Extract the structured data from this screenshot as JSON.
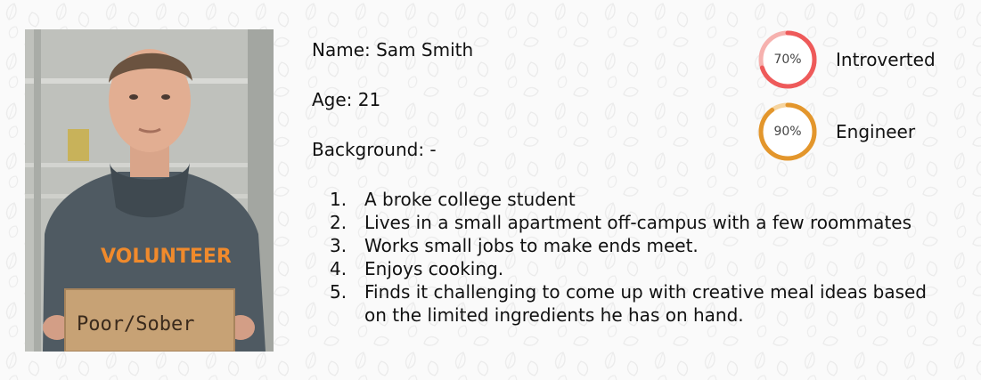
{
  "persona": {
    "name_line": "Name: Sam Smith",
    "age_line": "Age: 21",
    "background_line": "Background: -",
    "items": [
      {
        "num": "1.",
        "text": "A broke college student"
      },
      {
        "num": "2.",
        "text": "Lives in a small apartment off-campus with a few roommates"
      },
      {
        "num": "3.",
        "text": "Works small jobs to make ends meet."
      },
      {
        "num": "4.",
        "text": "Enjoys cooking."
      },
      {
        "num": "5.",
        "text": "Finds it challenging to come up with creative meal ideas based on the limited ingredients he has on hand."
      }
    ]
  },
  "photo": {
    "sign_text": "Poor/Sober",
    "shirt_text": "VOLUNTEER"
  },
  "stats": [
    {
      "value": "70%",
      "fraction": 0.7,
      "label": "Introverted",
      "color": "#ee5a5a",
      "track": "#f6b1ae"
    },
    {
      "value": "90%",
      "fraction": 0.9,
      "label": "Engineer",
      "color": "#e3962c",
      "track": "#f6d49e"
    }
  ]
}
